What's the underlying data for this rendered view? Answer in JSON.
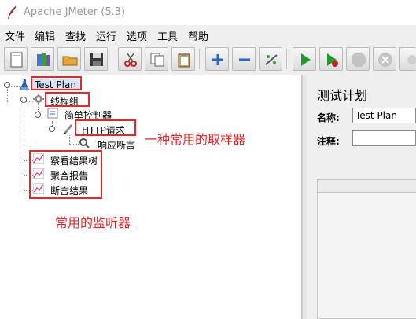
{
  "window": {
    "title": "Apache JMeter (5.3)"
  },
  "menu": [
    "文件",
    "编辑",
    "查找",
    "运行",
    "选项",
    "工具",
    "帮助"
  ],
  "toolbar": {
    "buttons": [
      "new-file-icon",
      "templates-icon",
      "open-folder-icon",
      "save-icon",
      "cut-icon",
      "copy-icon",
      "paste-icon",
      "expand-icon",
      "collapse-icon",
      "toggle-icon",
      "start-icon",
      "start-no-pause-icon",
      "stop-icon",
      "shutdown-icon",
      "clear-icon"
    ]
  },
  "tree": {
    "test_plan": "Test Plan",
    "thread_group": "线程组",
    "simple_controller": "简单控制器",
    "http_request": "HTTP请求",
    "response_assertion": "响应断言",
    "view_results_tree": "察看结果树",
    "aggregate_report": "聚合报告",
    "assertion_results": "断言结果"
  },
  "annotations": {
    "sampler_note": "一种常用的取样器",
    "listener_note": "常用的监听器"
  },
  "panel": {
    "heading": "测试计划",
    "name_label": "名称:",
    "name_value": "Test Plan",
    "comment_label": "注释:",
    "comment_value": ""
  },
  "colors": {
    "annotation_red": "#e8262a",
    "selection_blue": "#d6e4f3"
  }
}
